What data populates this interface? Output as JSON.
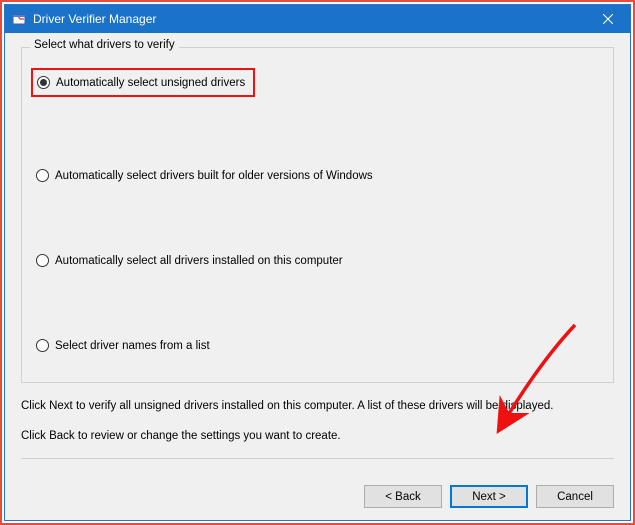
{
  "window": {
    "title": "Driver Verifier Manager",
    "icon": "verifier-icon",
    "close_label": "Close"
  },
  "group": {
    "legend": "Select what drivers to verify",
    "options": [
      {
        "label": "Automatically select unsigned drivers",
        "checked": true,
        "highlighted": true
      },
      {
        "label": "Automatically select drivers built for older versions of Windows",
        "checked": false,
        "highlighted": false
      },
      {
        "label": "Automatically select all drivers installed on this computer",
        "checked": false,
        "highlighted": false
      },
      {
        "label": "Select driver names from a list",
        "checked": false,
        "highlighted": false
      }
    ]
  },
  "info": {
    "line1": "Click Next to verify all unsigned drivers installed on this computer. A list of these drivers will be displayed.",
    "line2": "Click Back to review or change the settings you want to create."
  },
  "buttons": {
    "back": "< Back",
    "next": "Next >",
    "cancel": "Cancel"
  },
  "annotation": {
    "arrow_color": "#e11"
  }
}
